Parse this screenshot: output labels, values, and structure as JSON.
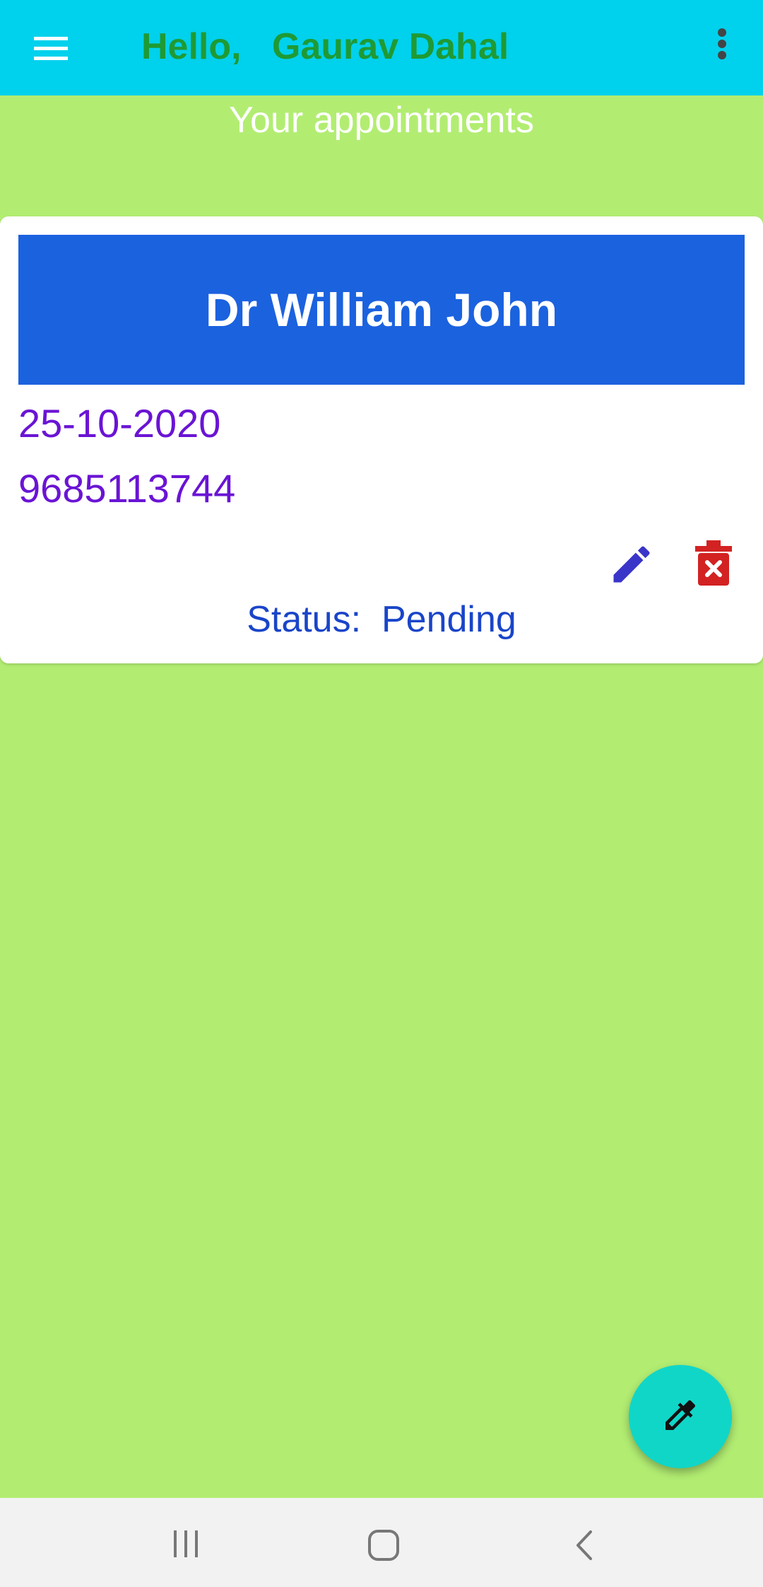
{
  "app_bar": {
    "greeting_prefix": "Hello,",
    "user_name": "Gaurav Dahal",
    "background_color": "#00d1ec",
    "title_color": "#1f9a34"
  },
  "page": {
    "title": "Your appointments",
    "background_color": "#b2ed72"
  },
  "appointment": {
    "doctor": "Dr William John",
    "date": "25-10-2020",
    "phone": "9685113744",
    "status_label": "Status:",
    "status_value": "Pending",
    "banner_color": "#1b62df"
  },
  "icons": {
    "menu": "menu-icon",
    "overflow": "more-vert-icon",
    "edit": "pencil-icon",
    "delete": "trash-x-icon",
    "fab": "eyedropper-icon"
  },
  "fab": {
    "color": "#10d6c8"
  }
}
